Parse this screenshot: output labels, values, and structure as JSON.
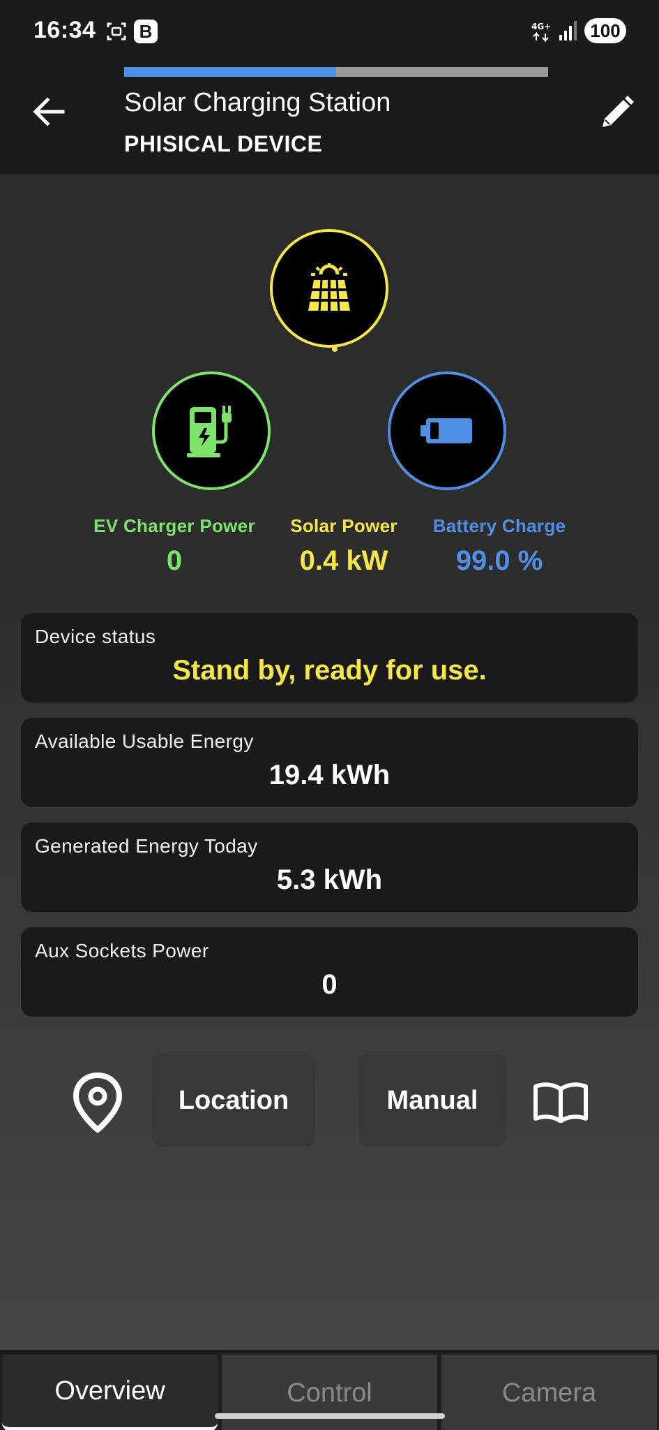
{
  "status_bar": {
    "time": "16:34",
    "app_badge": "B",
    "network": "4G+",
    "battery": "100"
  },
  "header": {
    "title": "Solar Charging Station",
    "subtitle": "PHISICAL DEVICE",
    "progress_fraction": 0.5
  },
  "metrics": {
    "ev": {
      "label": "EV Charger Power",
      "value": "0",
      "color": "#7ee36b",
      "icon": "ev-charger-icon"
    },
    "solar": {
      "label": "Solar Power",
      "value": "0.4 kW",
      "color": "#f5e74a",
      "icon": "solar-panel-icon"
    },
    "battery": {
      "label": "Battery Charge",
      "value": "99.0 %",
      "color": "#4f8fe6",
      "icon": "battery-icon"
    }
  },
  "cards": [
    {
      "label": "Device status",
      "value": "Stand by, ready for use."
    },
    {
      "label": "Available Usable Energy",
      "value": "19.4 kWh"
    },
    {
      "label": "Generated Energy Today",
      "value": "5.3 kWh"
    },
    {
      "label": "Aux Sockets Power",
      "value": "0"
    }
  ],
  "actions": {
    "location_label": "Location",
    "manual_label": "Manual"
  },
  "tabs": [
    {
      "label": "Overview",
      "selected": true
    },
    {
      "label": "Control",
      "selected": false
    },
    {
      "label": "Camera",
      "selected": false
    }
  ],
  "colors": {
    "accent_blue": "#4f8fe6",
    "accent_yellow": "#f5e74a",
    "accent_green": "#7ee36b"
  }
}
